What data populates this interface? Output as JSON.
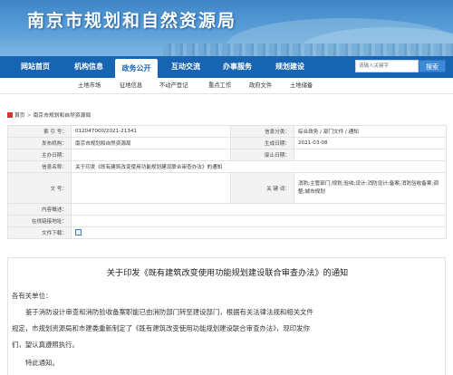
{
  "site": {
    "title": "南京市规划和自然资源局"
  },
  "nav": {
    "items": [
      "网站首页",
      "机构信息",
      "政务公开",
      "互动交流",
      "办事服务",
      "规划建设"
    ],
    "active_index": 2
  },
  "search": {
    "placeholder": "请输入关键字",
    "button": "搜索"
  },
  "subnav": {
    "items": [
      "土地市场",
      "征地信息",
      "不动产登记",
      "重点工作",
      "政府文件",
      "土地储备"
    ]
  },
  "breadcrumb": {
    "home": "首页",
    "current": "南京市规划和自然资源局"
  },
  "info": {
    "index_label": "索 引 号：",
    "index_value": "012047000/2021-21341",
    "category_label": "信息分类：",
    "category_value": "综合政务 / 部门文件 / 通知",
    "publisher_label": "发布机构：",
    "publisher_value": "南京市规划和自然资源局",
    "date_label": "生成日期：",
    "date_value": "2021-03-08",
    "subject_label": "主办日期：",
    "subject_value": "",
    "validity_label": "废止日期：",
    "validity_value": "",
    "name_label": "信息名称：",
    "name_value": "关于印发《既有建筑改变使用功能规划建设联合审查办法》的通知",
    "docno_label": "文 号：",
    "docno_value": "",
    "keywords_label": "关 键 词：",
    "keywords_value": "消防;主管部门;规划;验收;设计;消防设计;备案;消防验收备案;调整;城市规划",
    "content_label": "内容概述：",
    "content_value": "",
    "online_label": "在线链接地址：",
    "online_value": "",
    "download_label": "文件下载："
  },
  "article": {
    "title": "关于印发《既有建筑改变使用功能规划建设联合审查办法》的通知",
    "salutation": "各有关单位：",
    "para1_line1": "鉴于消防设计审查和消防验收备案职能已由消防部门转至建设部门，根据有关法律法规和相关文件",
    "para1_line2": "规定，市规划资源局和市建委重新制定了《既有建筑改变使用功能规划建设联合审查办法》，现印发你",
    "para1_line3": "们，望认真遵照执行。",
    "closing": "特此通知。"
  }
}
